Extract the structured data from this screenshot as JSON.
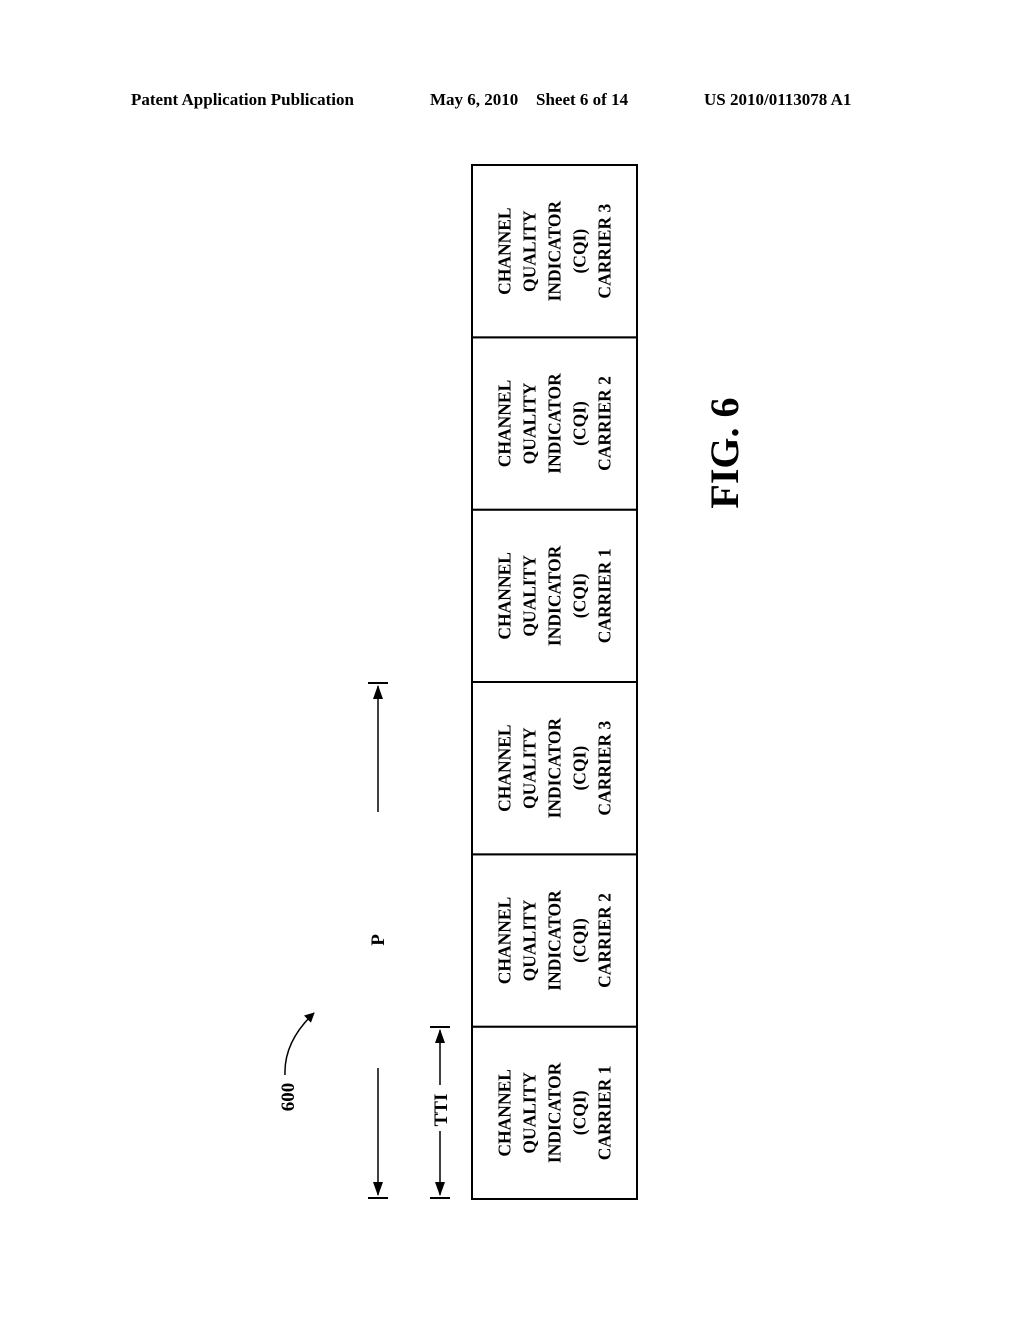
{
  "header": {
    "publication": "Patent Application Publication",
    "date": "May 6, 2010",
    "sheet": "Sheet 6 of 14",
    "number": "US 2010/0113078 A1"
  },
  "figure": {
    "reference": "600",
    "caption": "FIG. 6",
    "period_label": "P",
    "tti_label": "TTI",
    "cells": [
      {
        "lines": [
          "CHANNEL",
          "QUALITY",
          "INDICATOR",
          "(CQI)",
          "CARRIER 1"
        ]
      },
      {
        "lines": [
          "CHANNEL",
          "QUALITY",
          "INDICATOR",
          "(CQI)",
          "CARRIER 2"
        ]
      },
      {
        "lines": [
          "CHANNEL",
          "QUALITY",
          "INDICATOR",
          "(CQI)",
          "CARRIER 3"
        ]
      },
      {
        "lines": [
          "CHANNEL",
          "QUALITY",
          "INDICATOR",
          "(CQI)",
          "CARRIER 1"
        ]
      },
      {
        "lines": [
          "CHANNEL",
          "QUALITY",
          "INDICATOR",
          "(CQI)",
          "CARRIER 2"
        ]
      },
      {
        "lines": [
          "CHANNEL",
          "QUALITY",
          "INDICATOR",
          "(CQI)",
          "CARRIER 3"
        ]
      }
    ]
  }
}
